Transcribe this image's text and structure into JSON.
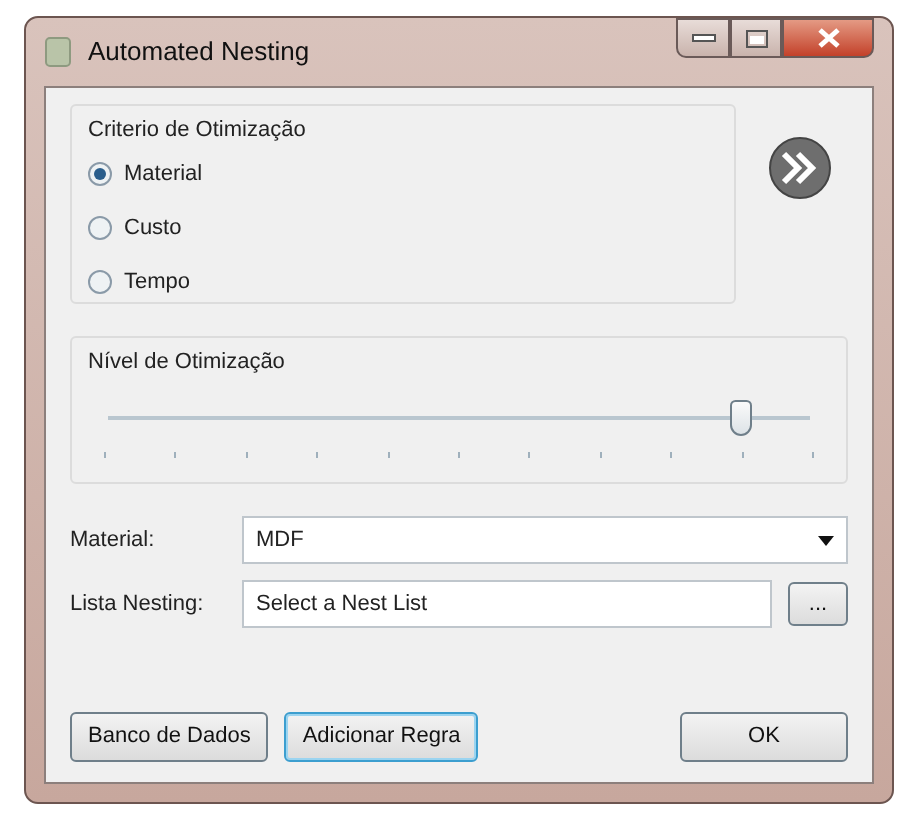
{
  "window": {
    "title": "Automated Nesting"
  },
  "criteria": {
    "title": "Criterio de Otimização",
    "options": [
      {
        "label": "Material",
        "selected": true
      },
      {
        "label": "Custo",
        "selected": false
      },
      {
        "label": "Tempo",
        "selected": false
      }
    ]
  },
  "level_group": {
    "title": "Nível de Otimização",
    "level": 0.9
  },
  "material": {
    "label": "Material:",
    "value": "MDF"
  },
  "nest_list": {
    "label": "Lista Nesting:",
    "value": "Select a Nest List",
    "browse": "..."
  },
  "buttons": [
    {
      "label": "Banco de Dados",
      "kind": "left",
      "focused": false
    },
    {
      "label": "Adicionar Regra",
      "kind": "left",
      "focused": true
    },
    {
      "label": "OK",
      "kind": "right",
      "focused": false
    }
  ]
}
